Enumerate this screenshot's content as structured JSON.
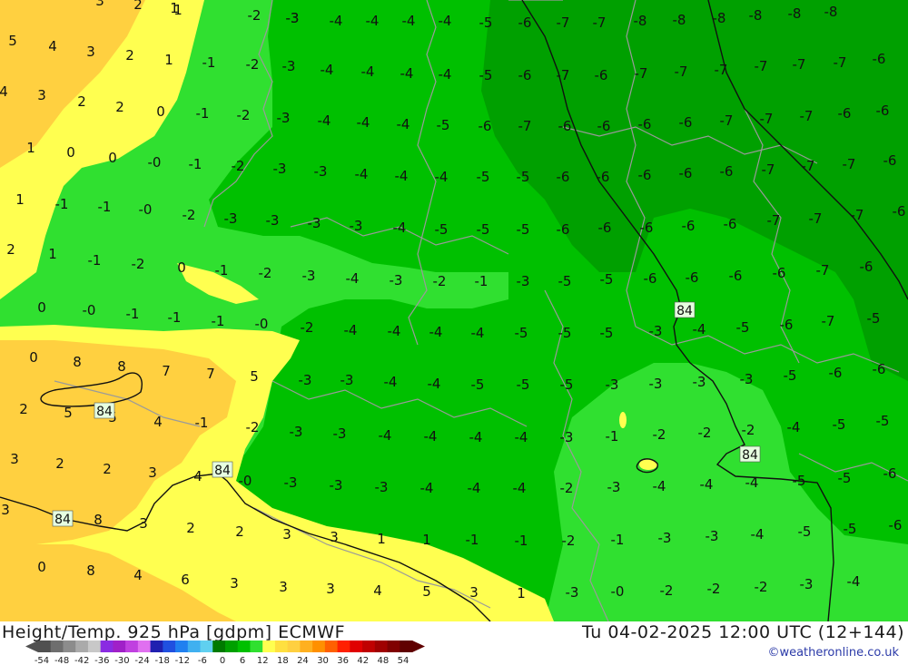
{
  "header": {
    "left_title": "Height/Temp. 925 hPa [gdpm] ECMWF",
    "right_title": "Tu 04-02-2025 12:00 UTC (12+144)",
    "credit": "©weatheronline.co.uk"
  },
  "legend": {
    "ticks": [
      "-54",
      "-48",
      "-42",
      "-36",
      "-30",
      "-24",
      "-18",
      "-12",
      "-6",
      "0",
      "6",
      "12",
      "18",
      "24",
      "30",
      "36",
      "42",
      "48",
      "54"
    ],
    "colors": [
      "#505050",
      "#6e6e6e",
      "#8c8c8c",
      "#aaaaaa",
      "#c8c8c8",
      "#8a2be2",
      "#a020c8",
      "#c040e0",
      "#e070f0",
      "#2020b0",
      "#2050e0",
      "#2080f0",
      "#40b0f0",
      "#60d0f0",
      "#007a00",
      "#00a000",
      "#00c000",
      "#30e030",
      "#ffff50",
      "#ffe040",
      "#ffd040",
      "#ffb020",
      "#ff9000",
      "#ff6000",
      "#ff2000",
      "#e00000",
      "#c00000",
      "#a00000",
      "#800000",
      "#600000"
    ]
  },
  "map": {
    "contour_labels": [
      "84",
      "84",
      "84",
      "84",
      "84"
    ],
    "temp_values": [
      "-3",
      "-2",
      "-3",
      "-4",
      "-4",
      "-4",
      "-4",
      "-5",
      "-6",
      "-7",
      "-7",
      "-8",
      "-8",
      "-8",
      "-8",
      "-8",
      "-8",
      "-1",
      "-2",
      "-3",
      "-4",
      "-4",
      "-4",
      "-4",
      "-5",
      "-6",
      "-7",
      "-6",
      "-7",
      "-7",
      "-7",
      "-7",
      "-7",
      "-7",
      "-6",
      "-1",
      "-2",
      "-3",
      "-4",
      "-4",
      "-4",
      "-5",
      "-6",
      "-7",
      "-6",
      "-6",
      "-6",
      "-6",
      "-7",
      "-7",
      "-7",
      "-6",
      "-6",
      "-0",
      "-1",
      "-2",
      "-3",
      "-3",
      "-4",
      "-4",
      "-4",
      "-5",
      "-5",
      "-6",
      "-6",
      "-6",
      "-6",
      "-6",
      "-7",
      "-7",
      "-7",
      "-6",
      "-1",
      "-1",
      "-0",
      "-2",
      "-3",
      "-3",
      "-3",
      "-3",
      "-4",
      "-5",
      "-5",
      "-5",
      "-6",
      "-6",
      "-6",
      "-6",
      "-6",
      "-7",
      "-7",
      "-7",
      "-6",
      "-1",
      "-2",
      "-1",
      "-2",
      "-3",
      "-4",
      "-3",
      "-2",
      "-1",
      "-3",
      "-5",
      "-5",
      "-6",
      "-6",
      "-6",
      "-6",
      "-7",
      "-6",
      "-0",
      "-1",
      "-1",
      "-1",
      "-0",
      "-2",
      "-4",
      "-4",
      "-4",
      "-4",
      "-5",
      "-5",
      "-5",
      "-3",
      "-4",
      "-5",
      "-6",
      "-7",
      "-5",
      "-3",
      "-3",
      "-4",
      "-4",
      "-5",
      "-5",
      "-5",
      "-3",
      "-3",
      "-3",
      "-3",
      "-5",
      "-6",
      "-6",
      "-1",
      "-2",
      "-3",
      "-3",
      "-4",
      "-4",
      "-4",
      "-4",
      "-3",
      "-1",
      "-2",
      "-2",
      "-2",
      "-4",
      "-5",
      "-5",
      "-0",
      "-3",
      "-3",
      "-3",
      "-4",
      "-4",
      "-4",
      "-2",
      "-3",
      "-4",
      "-4",
      "-4",
      "-5",
      "-5",
      "-6",
      "-1",
      "-1",
      "-2",
      "-1",
      "-3",
      "-3",
      "-4",
      "-5",
      "-5",
      "-6",
      "-3",
      "-0",
      "-2",
      "-2",
      "-2",
      "-3",
      "-4"
    ],
    "pos_values": [
      "3",
      "2",
      "1",
      "5",
      "4",
      "3",
      "2",
      "1",
      "4",
      "3",
      "2",
      "2",
      "0",
      "1",
      "0",
      "0",
      "1",
      "2",
      "1",
      "0",
      "0",
      "0",
      "8",
      "8",
      "7",
      "7",
      "5",
      "2",
      "5",
      "5",
      "4",
      "3",
      "2",
      "2",
      "3",
      "4",
      "3",
      "8",
      "3",
      "2",
      "2",
      "3",
      "3",
      "1",
      "1",
      "0",
      "8",
      "4",
      "6",
      "3",
      "3",
      "3",
      "4",
      "5",
      "3",
      "1",
      "1"
    ]
  }
}
